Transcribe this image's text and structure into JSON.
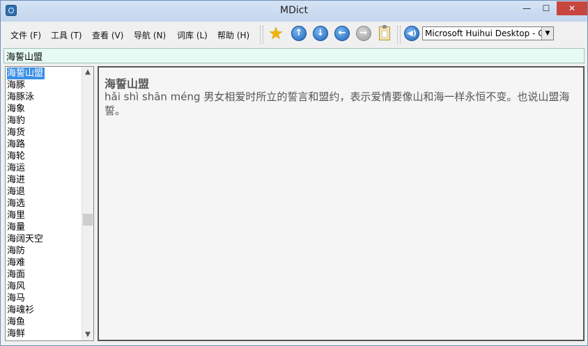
{
  "window": {
    "title": "MDict",
    "minimize": "—",
    "maximize": "☐",
    "close": "✕"
  },
  "menu": [
    "文件 (F)",
    "工具 (T)",
    "查看 (V)",
    "导航 (N)",
    "词库 (L)",
    "帮助 (H)"
  ],
  "toolbar": {
    "icons": [
      "star-icon",
      "arrow-up-icon",
      "arrow-down-icon",
      "arrow-left-icon",
      "arrow-right-icon",
      "clipboard-icon",
      "speaker-icon"
    ],
    "voice_selected": "Microsoft Huihui Desktop - Chinese (Simplified)"
  },
  "search": {
    "value": "海誓山盟"
  },
  "word_list": {
    "selected_index": 0,
    "items": [
      "海誓山盟",
      "海豚",
      "海豚泳",
      "海象",
      "海豹",
      "海货",
      "海路",
      "海轮",
      "海运",
      "海进",
      "海退",
      "海选",
      "海里",
      "海量",
      "海阔天空",
      "海防",
      "海难",
      "海面",
      "海风",
      "海马",
      "海魂衫",
      "海鱼",
      "海鲜"
    ]
  },
  "entry": {
    "headword": "海誓山盟",
    "definition": "hǎi shì shān méng 男女相爱时所立的誓言和盟约，表示爱情要像山和海一样永恒不变。也说山盟海誓。"
  },
  "colors": {
    "selection": "#3a8ee6",
    "search_bg": "#e6fbf4",
    "close_button": "#c7473f"
  }
}
